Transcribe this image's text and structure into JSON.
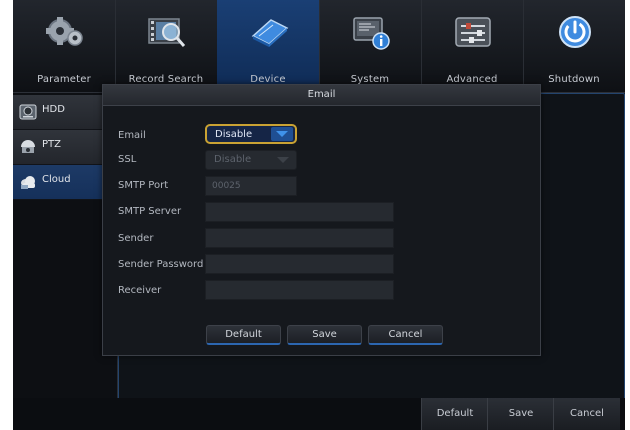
{
  "nav": {
    "tabs": [
      {
        "label": "Parameter",
        "icon": "gears-icon"
      },
      {
        "label": "Record Search",
        "icon": "film-search-icon"
      },
      {
        "label": "Device",
        "icon": "hard-drive-icon"
      },
      {
        "label": "System",
        "icon": "system-info-icon"
      },
      {
        "label": "Advanced",
        "icon": "sliders-icon"
      },
      {
        "label": "Shutdown",
        "icon": "power-icon"
      }
    ],
    "active_tab": "Device"
  },
  "sidebar": {
    "items": [
      {
        "label": "HDD",
        "icon": "hdd-icon"
      },
      {
        "label": "PTZ",
        "icon": "ptz-camera-icon"
      },
      {
        "label": "Cloud",
        "icon": "cloud-icon"
      }
    ],
    "active_item": "Cloud"
  },
  "dialog": {
    "title": "Email",
    "fields": {
      "email": {
        "label": "Email",
        "value": "Disable"
      },
      "ssl": {
        "label": "SSL",
        "value": "Disable"
      },
      "smtp_port": {
        "label": "SMTP Port",
        "value": "00025"
      },
      "smtp_server": {
        "label": "SMTP Server",
        "value": ""
      },
      "sender": {
        "label": "Sender",
        "value": ""
      },
      "sender_password": {
        "label": "Sender Password",
        "value": ""
      },
      "receiver": {
        "label": "Receiver",
        "value": ""
      }
    },
    "buttons": {
      "default": "Default",
      "save": "Save",
      "cancel": "Cancel"
    }
  },
  "bottom_buttons": {
    "default": "Default",
    "save": "Save",
    "cancel": "Cancel"
  },
  "colors": {
    "accent_blue": "#1a3f74",
    "focus_outline": "#c9a233",
    "dropdown_arrow": "#2f77d0"
  }
}
